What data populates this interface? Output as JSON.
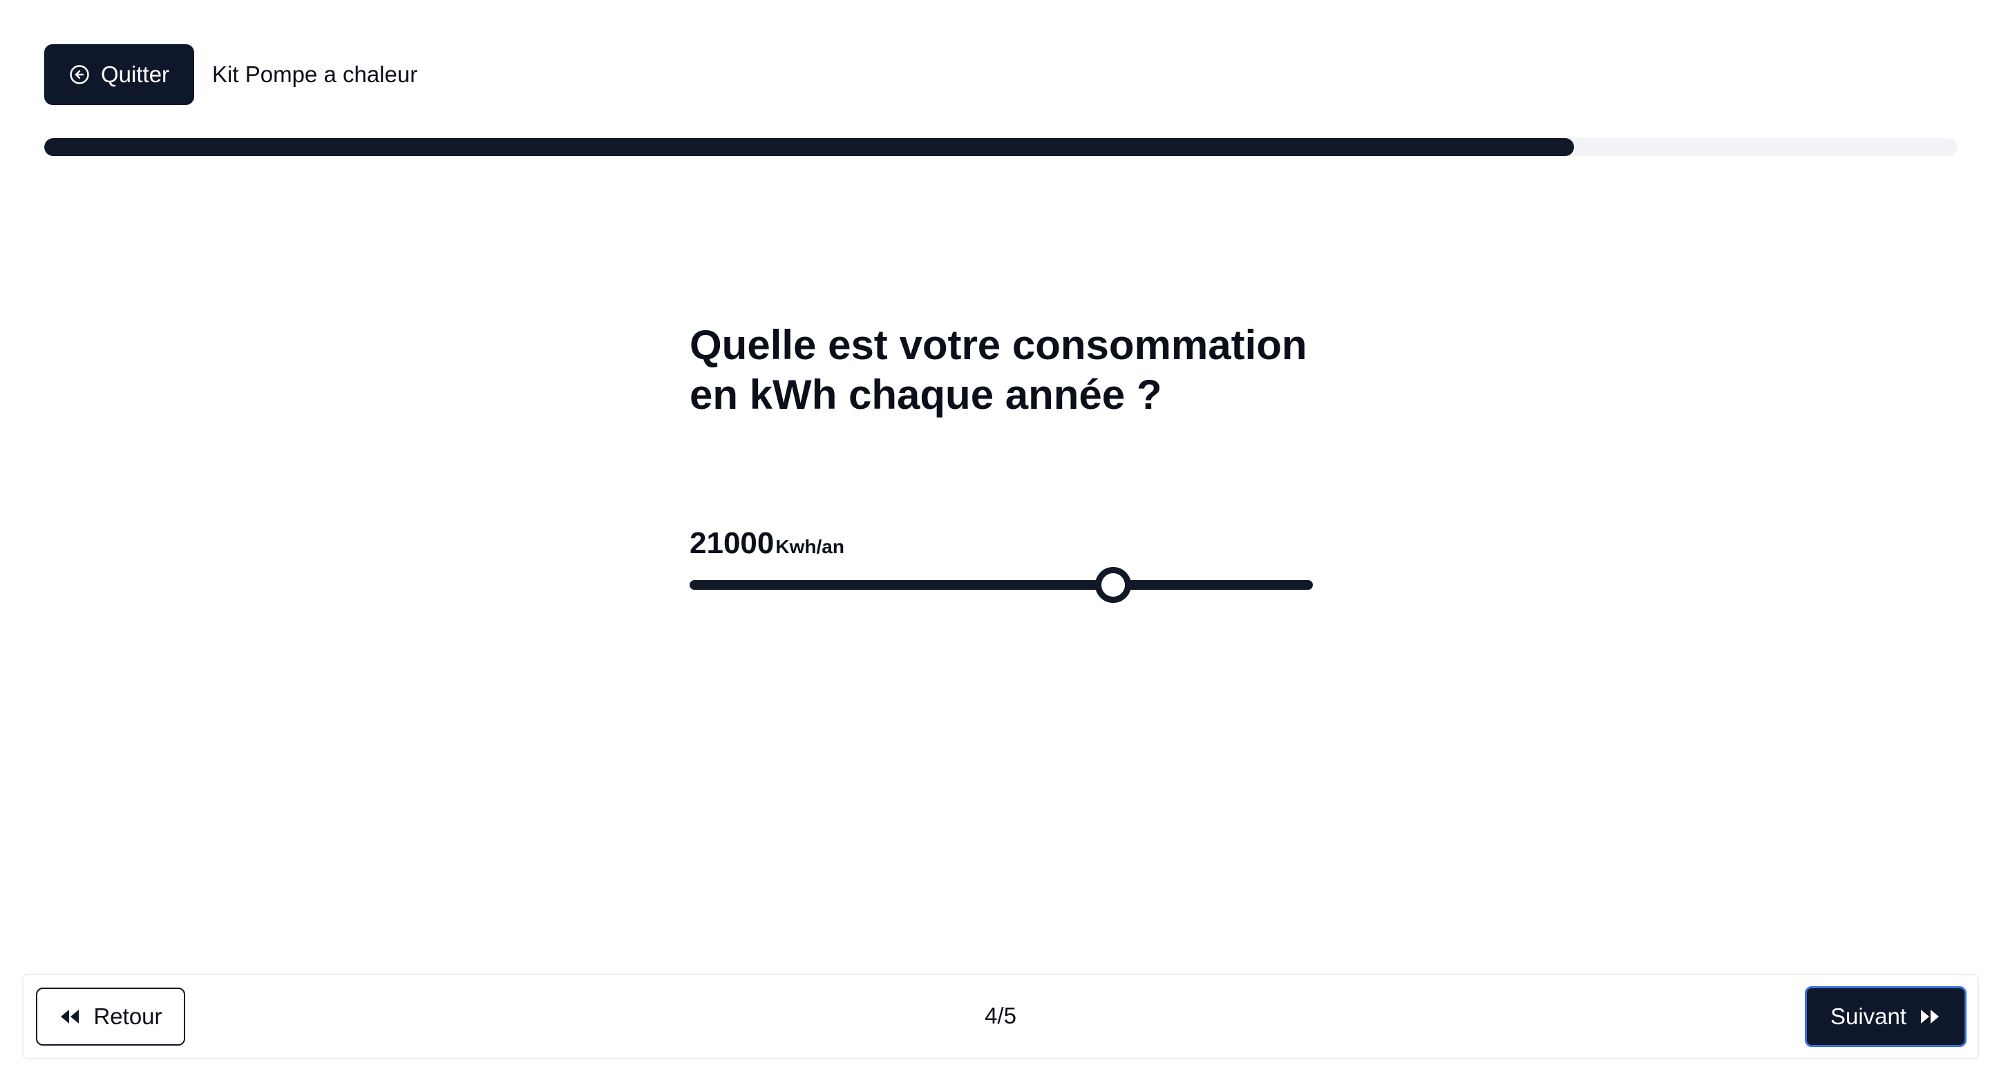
{
  "header": {
    "quit_label": "Quitter",
    "title": "Kit Pompe a chaleur"
  },
  "progress": {
    "value": 0.8
  },
  "question": {
    "title": "Quelle est votre consommation en kWh chaque année ?",
    "value": "21000",
    "unit": "Kwh/an",
    "slider_fraction": 0.68
  },
  "footer": {
    "back_label": "Retour",
    "step_text": "4/5",
    "next_label": "Suivant"
  },
  "colors": {
    "primary": "#0f172a",
    "track_bg": "#f1f3f6",
    "focus_ring": "#3b6fd8"
  },
  "icons": {
    "quit": "circle-arrow-left-icon",
    "back": "rewind-icon",
    "next": "fast-forward-icon"
  }
}
